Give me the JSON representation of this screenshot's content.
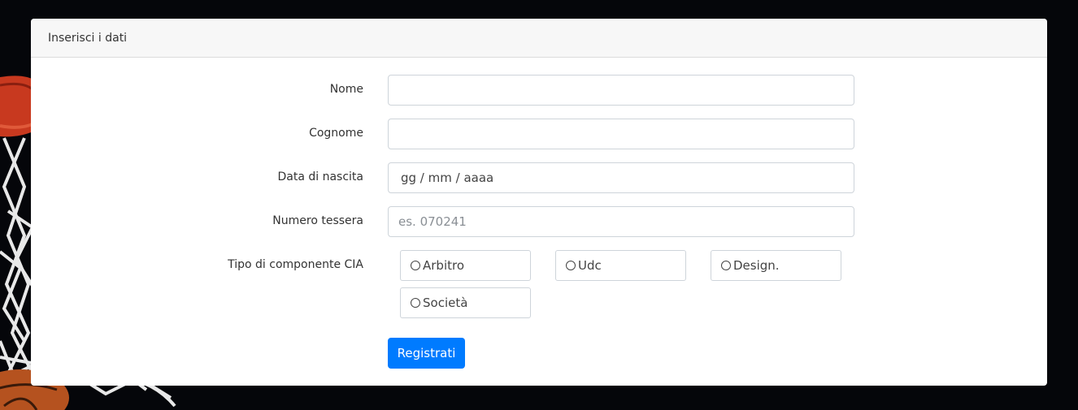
{
  "card": {
    "header_title": "Inserisci i dati"
  },
  "form": {
    "nome": {
      "label": "Nome",
      "value": "",
      "placeholder": ""
    },
    "cognome": {
      "label": "Cognome",
      "value": "",
      "placeholder": ""
    },
    "data_nascita": {
      "label": "Data di nascita",
      "placeholder": "gg / mm / aaaa"
    },
    "numero_tessera": {
      "label": "Numero tessera",
      "value": "",
      "placeholder": "es. 070241"
    },
    "tipo_componente": {
      "label": "Tipo di componente CIA",
      "options": [
        "Arbitro",
        "Udc",
        "Design.",
        "Società"
      ]
    },
    "submit_label": "Registrati"
  },
  "colors": {
    "page_background": "#05060a",
    "primary": "#007bff",
    "card_header_bg": "#f7f7f7"
  }
}
